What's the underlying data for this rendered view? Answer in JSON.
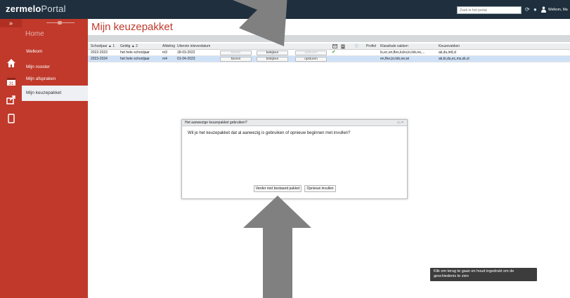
{
  "app": {
    "logo_main": "zermelo",
    "logo_sub": "Portal",
    "search_placeholder": "Zoek in het portal",
    "user_label": "Welkom, Ma"
  },
  "sidebar": {
    "collapse_icon": "double-chevron-right-icon",
    "home_label": "Home",
    "items": [
      {
        "label": "Welkom",
        "icon": "home-icon"
      },
      {
        "label": "Mijn rooster",
        "icon": "calendar-icon",
        "calendar_day": "31"
      },
      {
        "label": "Mijn afspraken",
        "icon": "share-icon"
      },
      {
        "label": "Mijn keuzepakket",
        "icon": "tablet-icon"
      }
    ]
  },
  "page": {
    "title": "Mijn keuzepakket"
  },
  "grid": {
    "headers": {
      "schooljaar": "Schooljaar",
      "geldig": "Geldig",
      "afdeling": "Afdeling",
      "uiterste": "Uiterste inleverdatum",
      "profiel": "Profiel",
      "klassikale": "Klassikale vakken",
      "keuzevakken": "Keuzevakken"
    },
    "sort_marks": {
      "schooljaar": "▲ 1",
      "geldig": "▲ 2"
    },
    "rows": [
      {
        "schooljaar": "2022-2023",
        "geldig": "het hele schooljaar",
        "afdeling": "m3",
        "uiterste": "18-03-2022",
        "kiezen": "kiezen",
        "bekijken": "bekijken",
        "opsturen": "opsturen",
        "checked": "✔",
        "klassikale": "lo,ec,en,flex,kckv,lo,lob,ne,...",
        "keuzevakken": "ak,du,intl,sl"
      },
      {
        "schooljaar": "2023-2024",
        "geldig": "het hele schooljaar",
        "afdeling": "m4",
        "uiterste": "01-04-2023",
        "kiezen": "kiezen",
        "bekijken": "bekijken",
        "opsturen": "opsturen",
        "checked": "",
        "klassikale": "en,flex,lo,lob,ne,wi",
        "keuzevakken": "ak,bi,du,ec,ms,sk,sl"
      }
    ]
  },
  "dialog": {
    "title": "Het aanwezige keuzepakket gebruiken?",
    "controls": "▭ ×",
    "message": "Wil je het keuzepakket dat al aanwezig is gebruiken of opnieuw beginnen met invullen?",
    "btn_continue": "Verder met bestaand pakket",
    "btn_restart": "Opnieuw invullen"
  },
  "tooltip": {
    "text": "Klik om terug te gaan en houd ingedrukt om de geschiedenis te zien"
  },
  "colors": {
    "nav_red": "#c0392b",
    "topbar": "#1f2f3d",
    "selected_row": "#cfe1f7",
    "arrow": "#808080"
  }
}
